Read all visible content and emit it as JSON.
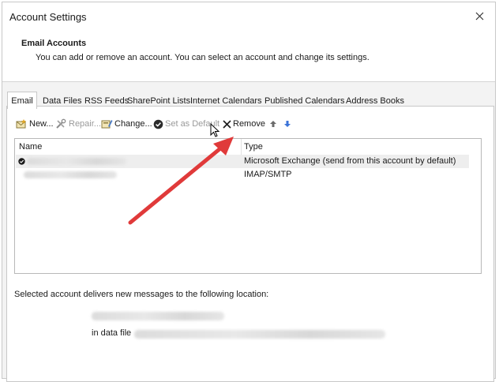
{
  "window": {
    "title": "Account Settings"
  },
  "header": {
    "title": "Email Accounts",
    "description": "You can add or remove an account. You can select an account and change its settings."
  },
  "tabs": [
    {
      "label": "Email",
      "active": true
    },
    {
      "label": "Data Files",
      "active": false
    },
    {
      "label": "RSS Feeds",
      "active": false
    },
    {
      "label": "SharePoint Lists",
      "active": false
    },
    {
      "label": "Internet Calendars",
      "active": false
    },
    {
      "label": "Published Calendars",
      "active": false
    },
    {
      "label": "Address Books",
      "active": false
    }
  ],
  "toolbar": {
    "new_label": "New...",
    "repair_label": "Repair...",
    "change_label": "Change...",
    "set_default_label": "Set as Default",
    "remove_label": "Remove"
  },
  "accounts": {
    "col_name": "Name",
    "col_type": "Type",
    "rows": [
      {
        "type": "Microsoft Exchange (send from this account by default)",
        "default": true,
        "selected": true
      },
      {
        "type": "IMAP/SMTP",
        "default": false,
        "selected": false
      }
    ]
  },
  "footer": {
    "delivery_text": "Selected account delivers new messages to the following location:",
    "data_file_label": "in data file"
  },
  "colors": {
    "annotation_arrow": "#e03a3a",
    "toolbar_arrow": "#3b73d8"
  }
}
